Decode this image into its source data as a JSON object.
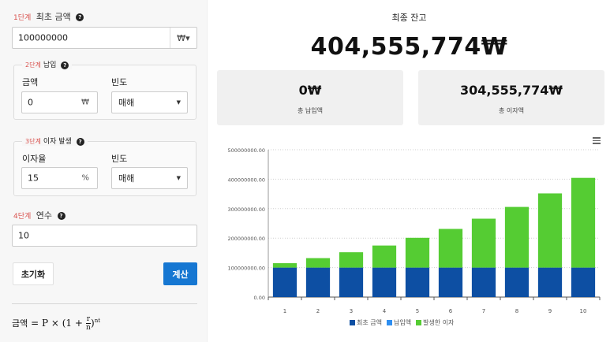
{
  "left_panel": {
    "step1": {
      "num": "1단계",
      "label": "최초 금액",
      "value": "100000000",
      "currency_button": "₩▾"
    },
    "step2": {
      "num": "2단계",
      "label": "납입",
      "amount_label": "금액",
      "amount_value": "0",
      "amount_suffix": "₩",
      "freq_label": "빈도",
      "freq_value": "매해"
    },
    "step3": {
      "num": "3단계",
      "label": "이자 발생",
      "rate_label": "이자율",
      "rate_value": "15",
      "rate_suffix": "%",
      "freq_label": "빈도",
      "freq_value": "매해"
    },
    "step4": {
      "num": "4단계",
      "label": "연수",
      "value": "10"
    },
    "reset_label": "초기화",
    "calc_label": "계산",
    "formula": {
      "prefix": "금액",
      "eq": "= P × (1 + ",
      "num": "r",
      "den": "n",
      "close": ")",
      "exp": "nt"
    }
  },
  "result": {
    "final_label": "최종 잔고",
    "final_value": "404,555,774₩",
    "total_deposit_value": "0₩",
    "total_deposit_label": "총 납입액",
    "total_interest_value": "304,555,774₩",
    "total_interest_label": "총 이자액"
  },
  "colors": {
    "principal": "#0d4fa3",
    "deposit": "#2e8ef0",
    "interest": "#55cc33"
  },
  "icons": {
    "help": "help-circle-icon",
    "menu": "hamburger-menu-icon",
    "select_caret": "caret-down-icon"
  },
  "chart_data": {
    "type": "bar",
    "stacked": true,
    "categories": [
      "1",
      "2",
      "3",
      "4",
      "5",
      "6",
      "7",
      "8",
      "9",
      "10"
    ],
    "series": [
      {
        "name": "최초 금액",
        "values": [
          100000000,
          100000000,
          100000000,
          100000000,
          100000000,
          100000000,
          100000000,
          100000000,
          100000000,
          100000000
        ]
      },
      {
        "name": "납입액",
        "values": [
          0,
          0,
          0,
          0,
          0,
          0,
          0,
          0,
          0,
          0
        ]
      },
      {
        "name": "발생한 이자",
        "values": [
          15000000,
          32250000,
          52087500,
          74900625,
          101135719,
          131306077,
          166001988,
          205902286,
          251787629,
          304555774
        ]
      }
    ],
    "y_ticks": [
      "0.00",
      "100000000.00",
      "200000000.00",
      "300000000.00",
      "400000000.00",
      "500000000.00"
    ],
    "ylim": [
      0,
      500000000
    ],
    "grid": true,
    "legend": "bottom"
  }
}
